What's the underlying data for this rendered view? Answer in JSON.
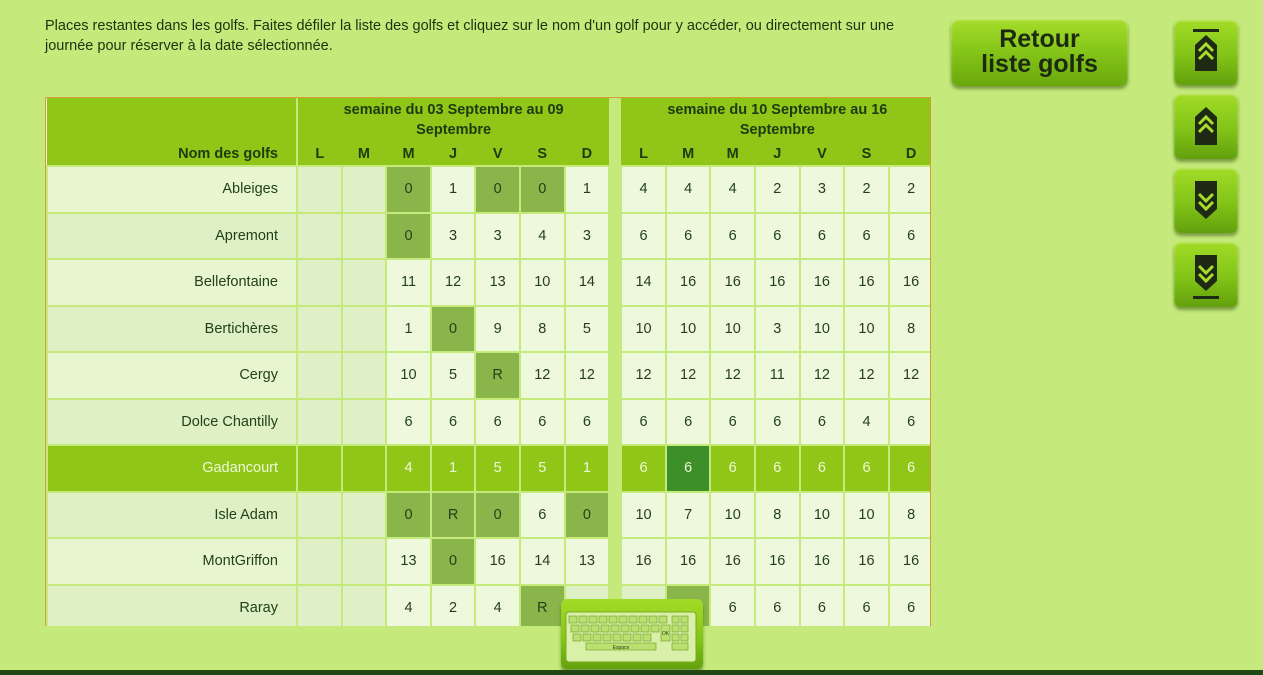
{
  "intro": "Places restantes dans les golfs. Faites défiler la liste des golfs et cliquez sur le nom d'un golf pour y accéder, ou directement sur une journée pour réserver à la date sélectionnée.",
  "retour_line1": "Retour",
  "retour_line2": "liste golfs",
  "nav_buttons": [
    "top-icon",
    "page-up-icon",
    "page-down-icon",
    "bottom-icon"
  ],
  "week1_title": "semaine du 03 Septembre au 09 Septembre",
  "week2_title": "semaine du 10 Septembre au 16 Septembre",
  "name_header": "Nom des golfs",
  "days": [
    "L",
    "M",
    "M",
    "J",
    "V",
    "S",
    "D"
  ],
  "rows": [
    {
      "name": "Ableiges",
      "w1": [
        "",
        "",
        "0",
        "1",
        "0",
        "0",
        "1"
      ],
      "w2": [
        "4",
        "4",
        "4",
        "2",
        "3",
        "2",
        "2"
      ],
      "dark1": [
        2,
        4,
        5
      ],
      "dark2": []
    },
    {
      "name": "Apremont",
      "w1": [
        "",
        "",
        "0",
        "3",
        "3",
        "4",
        "3"
      ],
      "w2": [
        "6",
        "6",
        "6",
        "6",
        "6",
        "6",
        "6"
      ],
      "dark1": [
        2
      ],
      "dark2": []
    },
    {
      "name": "Bellefontaine",
      "w1": [
        "",
        "",
        "11",
        "12",
        "13",
        "10",
        "14"
      ],
      "w2": [
        "14",
        "16",
        "16",
        "16",
        "16",
        "16",
        "16"
      ],
      "dark1": [],
      "dark2": []
    },
    {
      "name": "Bertichères",
      "w1": [
        "",
        "",
        "1",
        "0",
        "9",
        "8",
        "5"
      ],
      "w2": [
        "10",
        "10",
        "10",
        "3",
        "10",
        "10",
        "8"
      ],
      "dark1": [
        3
      ],
      "dark2": []
    },
    {
      "name": "Cergy",
      "w1": [
        "",
        "",
        "10",
        "5",
        "R",
        "12",
        "12"
      ],
      "w2": [
        "12",
        "12",
        "12",
        "11",
        "12",
        "12",
        "12"
      ],
      "dark1": [
        4
      ],
      "dark2": []
    },
    {
      "name": "Dolce Chantilly",
      "w1": [
        "",
        "",
        "6",
        "6",
        "6",
        "6",
        "6"
      ],
      "w2": [
        "6",
        "6",
        "6",
        "6",
        "6",
        "4",
        "6"
      ],
      "dark1": [],
      "dark2": []
    },
    {
      "name": "Gadancourt",
      "w1": [
        "",
        "",
        "4",
        "1",
        "5",
        "5",
        "1"
      ],
      "w2": [
        "6",
        "6",
        "6",
        "6",
        "6",
        "6",
        "6"
      ],
      "dark1": [],
      "dark2": [],
      "selected": true,
      "highlight2": 1
    },
    {
      "name": "Isle Adam",
      "w1": [
        "",
        "",
        "0",
        "R",
        "0",
        "6",
        "0"
      ],
      "w2": [
        "10",
        "7",
        "10",
        "8",
        "10",
        "10",
        "8"
      ],
      "dark1": [
        2,
        3,
        4,
        6
      ],
      "dark2": []
    },
    {
      "name": "MontGriffon",
      "w1": [
        "",
        "",
        "13",
        "0",
        "16",
        "14",
        "13"
      ],
      "w2": [
        "16",
        "16",
        "16",
        "16",
        "16",
        "16",
        "16"
      ],
      "dark1": [
        3
      ],
      "dark2": []
    },
    {
      "name": "Raray",
      "w1": [
        "",
        "",
        "4",
        "2",
        "4",
        "R",
        ""
      ],
      "w2": [
        "",
        "",
        "6",
        "6",
        "6",
        "6",
        "6"
      ],
      "dark1": [
        5
      ],
      "dark2": [
        1
      ]
    }
  ],
  "keyboard_space_label": "Espace",
  "keyboard_ok_label": "OK"
}
